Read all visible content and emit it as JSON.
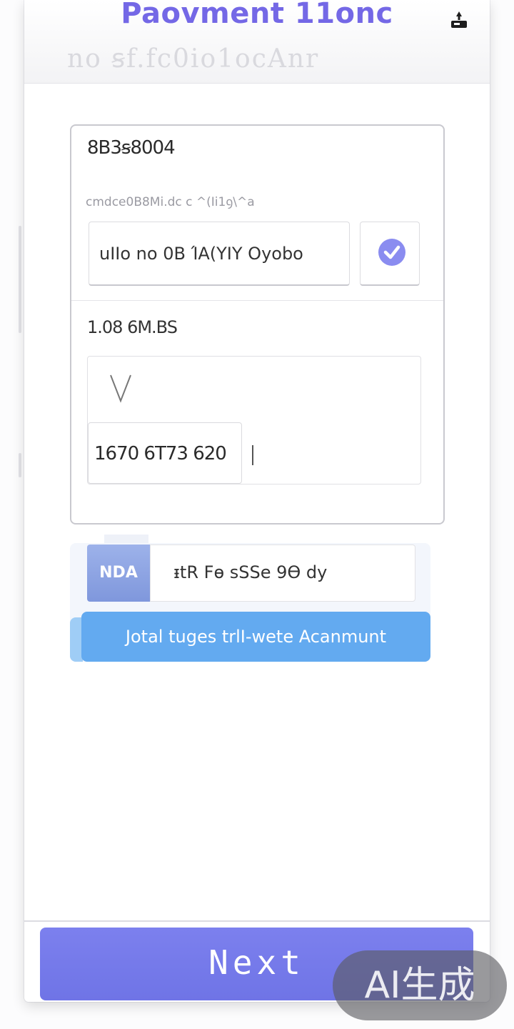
{
  "header": {
    "title": "Paovment 11onc",
    "subtitle": "no ꞩf.fc0io1ocAnr",
    "icon": "upload-icon"
  },
  "form": {
    "code": "8B3ꞩ8004",
    "caption": "cmdce0B8Mi.dc c ^(Ii1ꝯ\\^a",
    "name_value": "uIIo no 0B ΊA(YIY Oyobo",
    "name_check_icon": "check-circle-icon",
    "amount_label": "1.08 6M.BS",
    "chevron_icon": "chevron-down-icon",
    "card_number": "1670 6T73 620"
  },
  "promo": {
    "badge": "NDA",
    "value": "ᵻtR Fѳ sSSe 9Ѳ dy",
    "button": "Jotal tuges trlI-wete Acanmunt"
  },
  "footer": {
    "next": "Next"
  },
  "watermark": {
    "text": "AI生成"
  },
  "colors": {
    "accent": "#7468e6",
    "next_button": "#7479ea",
    "promo_button": "#63aaf0",
    "promo_badge": "#8aa0e2",
    "check": "#8a8cf0"
  }
}
